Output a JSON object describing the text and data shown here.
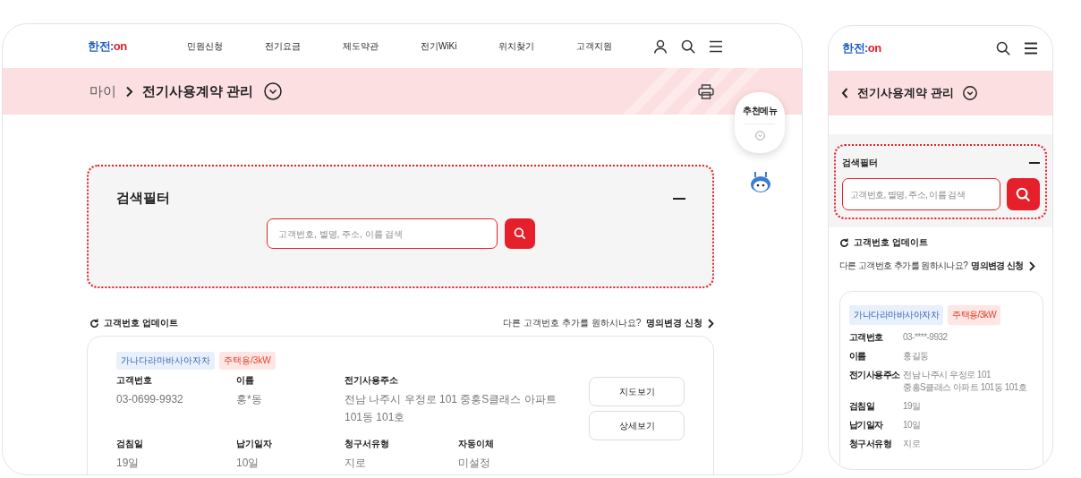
{
  "desktop": {
    "logo": [
      {
        "text": "한전:",
        "color": "#1f5fbf"
      },
      {
        "text": "on",
        "color": "#e5202b"
      }
    ],
    "nav": [
      "민원신청",
      "전기요금",
      "제도약관",
      "전기WiKi",
      "위치찾기",
      "고객지원"
    ],
    "breadcrumb": {
      "parent": "마이",
      "current": "전기사용계약 관리"
    },
    "filter": {
      "title": "검색필터",
      "placeholder": "고객번호, 별명, 주소, 이름 검색"
    },
    "update_link": "고객번호 업데이트",
    "change_prompt": {
      "question": "다른 고객번호 추가를 원하시나요?",
      "link": "명의변경 신청"
    },
    "card": {
      "tags": [
        {
          "text": "가나다라마바사아자차",
          "kind": "alias"
        },
        {
          "text": "주택용/3kW",
          "kind": "usage"
        }
      ],
      "fields": [
        {
          "label": "고객번호",
          "value": [
            "03-0699-9932"
          ]
        },
        {
          "label": "이름",
          "value": [
            "홍*동"
          ]
        },
        {
          "label": "전기사용주소",
          "value": [
            "전남 나주시 우정로 101 중흥S클래스 아파트",
            "101동 101호"
          ],
          "kind": "wide"
        },
        {
          "label": "검침일",
          "value": [
            "19일"
          ]
        },
        {
          "label": "납기일자",
          "value": [
            "10일"
          ]
        },
        {
          "label": "청구서유형",
          "value": [
            "지로"
          ]
        },
        {
          "label": "자동이체",
          "value": [
            "미설정"
          ]
        }
      ],
      "buttons": [
        "지도보기",
        "상세보기"
      ]
    }
  },
  "floating_menu": {
    "label": "추천메뉴"
  },
  "mobile": {
    "logo": [
      {
        "text": "한전:",
        "color": "#1f5fbf"
      },
      {
        "text": "on",
        "color": "#e5202b"
      }
    ],
    "title": "전기사용계약 관리",
    "filter": {
      "title": "검색필터",
      "placeholder": "고객번호, 별명, 주소, 이름 검색"
    },
    "update_link": "고객번호 업데이트",
    "change_prompt": {
      "question": "다른 고객번호 추가를 원하시나요?",
      "link": "명의변경 신청"
    },
    "card": {
      "tags": [
        {
          "text": "가나다라마바사아자차",
          "kind": "alias"
        },
        {
          "text": "주택용/3kW",
          "kind": "usage"
        }
      ],
      "fields": [
        {
          "label": "고객번호",
          "value": [
            "03-****-9932"
          ]
        },
        {
          "label": "이름",
          "value": [
            "홍길동"
          ]
        },
        {
          "label": "전기사용주소",
          "value": [
            "전남 나주시 우정로 101",
            "중흥S클래스 아파트 101동 101호"
          ]
        },
        {
          "label": "검침일",
          "value": [
            "19일"
          ]
        },
        {
          "label": "납기일자",
          "value": [
            "10일"
          ]
        },
        {
          "label": "청구서유형",
          "value": [
            "지로"
          ]
        }
      ]
    }
  }
}
